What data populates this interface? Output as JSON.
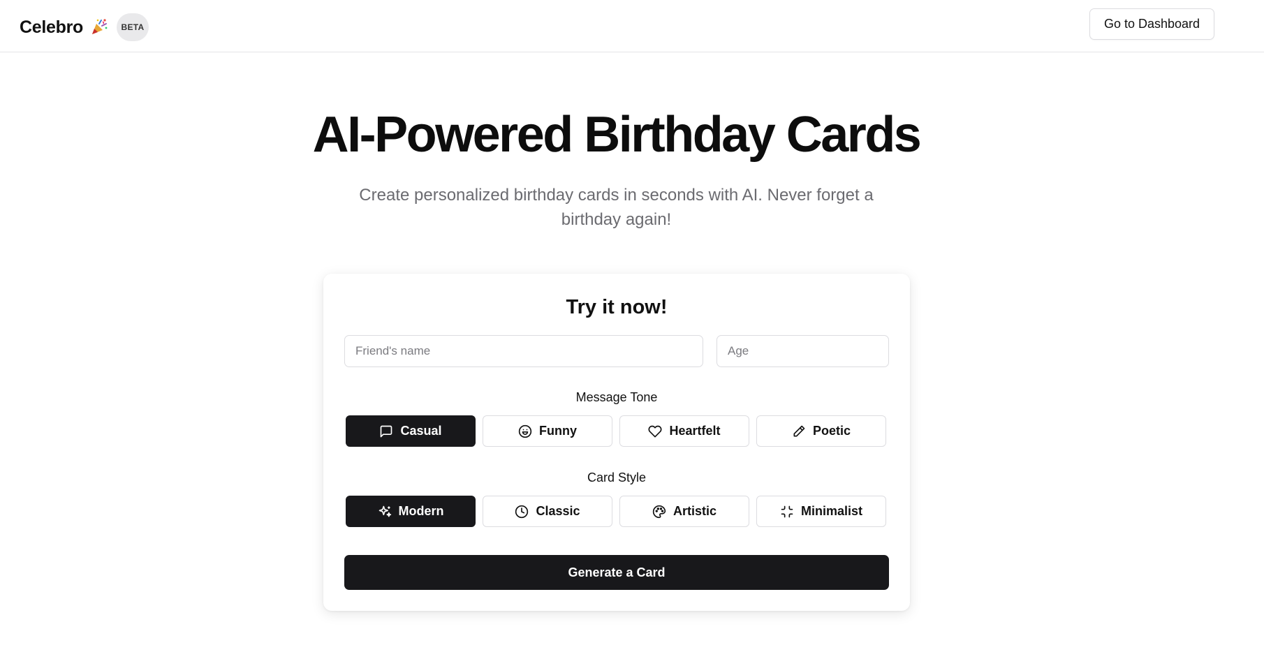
{
  "header": {
    "brand": "Celebro",
    "brand_icon": "party-popper-icon",
    "badge": "BETA",
    "dashboard_button": "Go to Dashboard"
  },
  "hero": {
    "title": "AI-Powered Birthday Cards",
    "subtitle": "Create personalized birthday cards in seconds with AI. Never forget a birthday again!"
  },
  "form": {
    "title": "Try it now!",
    "name_placeholder": "Friend's name",
    "age_placeholder": "Age",
    "tone_label": "Message Tone",
    "tones": [
      {
        "label": "Casual",
        "icon": "message-square-icon",
        "selected": true
      },
      {
        "label": "Funny",
        "icon": "laugh-icon",
        "selected": false
      },
      {
        "label": "Heartfelt",
        "icon": "heart-icon",
        "selected": false
      },
      {
        "label": "Poetic",
        "icon": "pencil-icon",
        "selected": false
      }
    ],
    "style_label": "Card Style",
    "styles": [
      {
        "label": "Modern",
        "icon": "sparkles-icon",
        "selected": true
      },
      {
        "label": "Classic",
        "icon": "clock-icon",
        "selected": false
      },
      {
        "label": "Artistic",
        "icon": "palette-icon",
        "selected": false
      },
      {
        "label": "Minimalist",
        "icon": "minimize-icon",
        "selected": false
      }
    ],
    "generate_button": "Generate a Card"
  },
  "colors": {
    "accent_dark": "#18181b",
    "muted_text": "#6b6b70",
    "border": "#dcdce0"
  }
}
